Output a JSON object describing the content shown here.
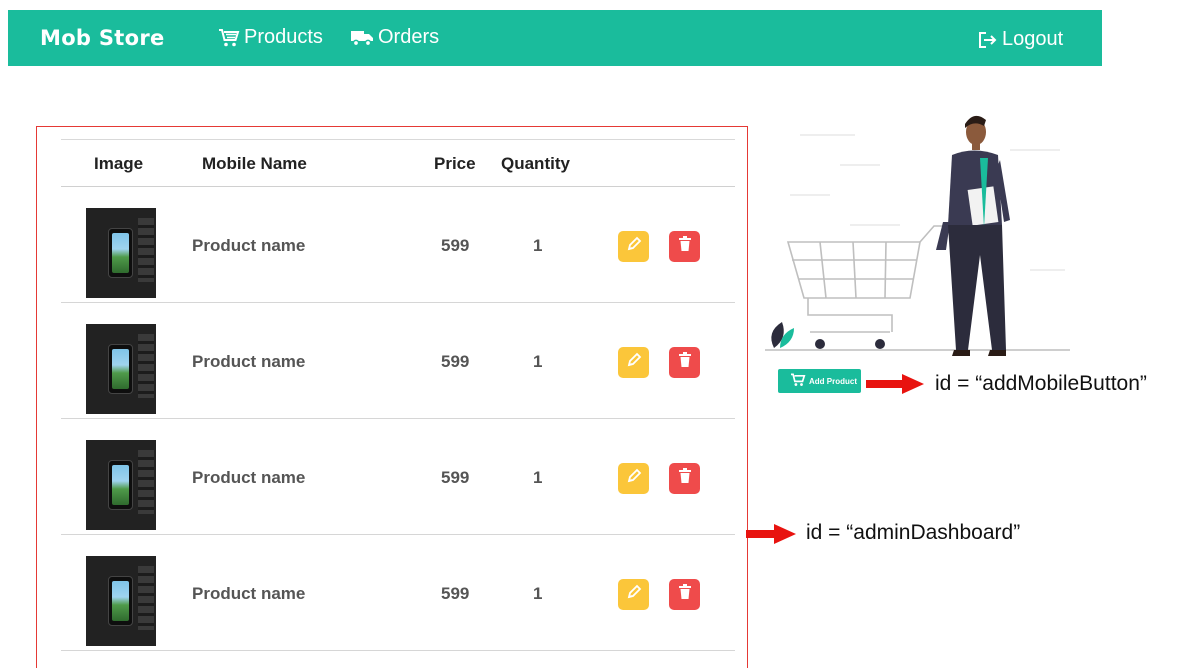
{
  "navbar": {
    "brand": "Mob Store",
    "products": "Products",
    "orders": "Orders",
    "logout": "Logout",
    "bg_color": "#1abc9c"
  },
  "table": {
    "columns": [
      "Image",
      "Mobile Name",
      "Price",
      "Quantity"
    ],
    "rows": [
      {
        "name": "Product name",
        "price": "599",
        "quantity": "1"
      },
      {
        "name": "Product name",
        "price": "599",
        "quantity": "1"
      },
      {
        "name": "Product name",
        "price": "599",
        "quantity": "1"
      },
      {
        "name": "Product name",
        "price": "599",
        "quantity": "1"
      }
    ]
  },
  "add_button": {
    "label": "Add Product"
  },
  "annotations": {
    "add_mobile": "id = “addMobileButton”",
    "admin_dashboard": "id = “adminDashboard”"
  },
  "colors": {
    "accent": "#1abc9c",
    "edit": "#fbc63a",
    "delete": "#ef4b4b",
    "highlight": "#e53935"
  },
  "icons": [
    "cart-icon",
    "truck-icon",
    "logout-icon",
    "pencil-icon",
    "trash-icon"
  ]
}
